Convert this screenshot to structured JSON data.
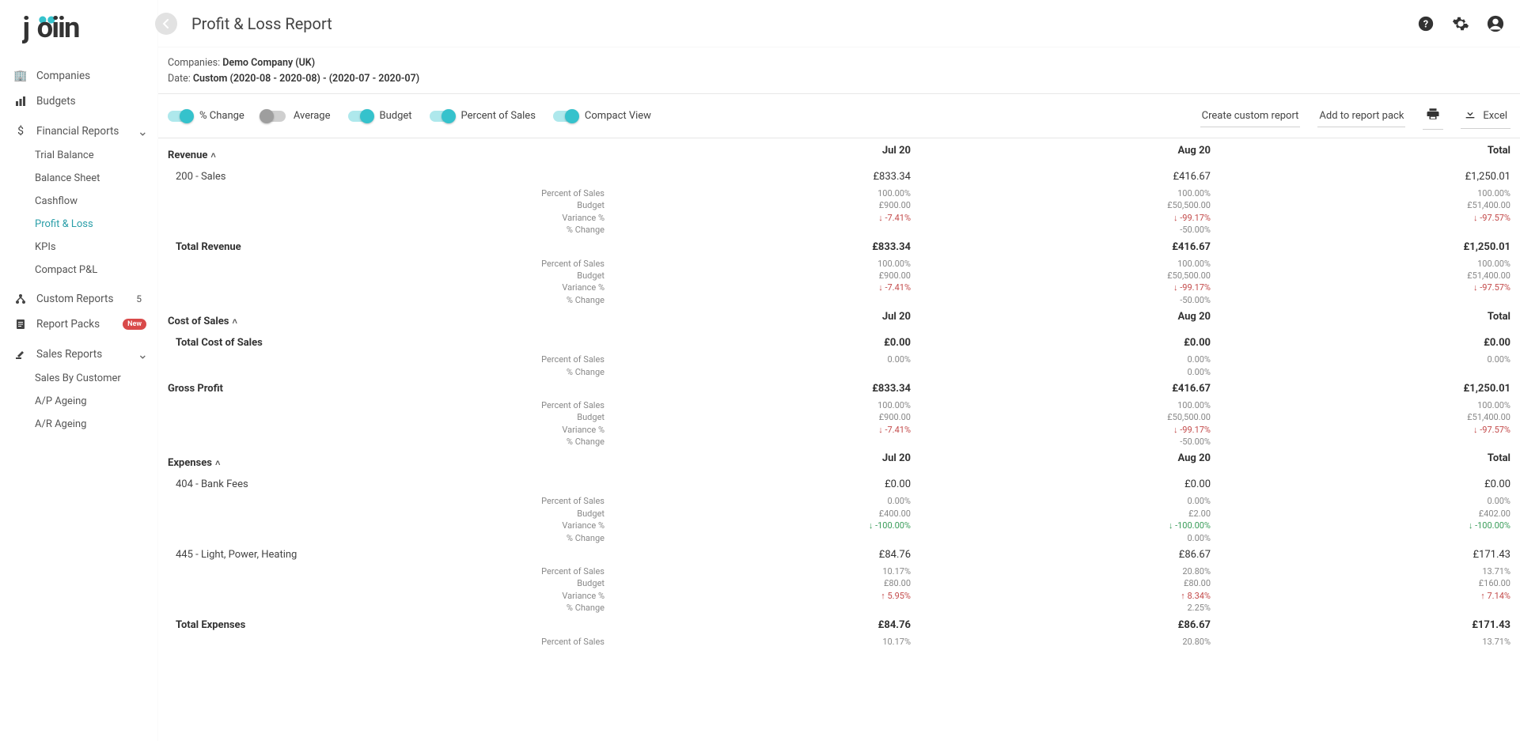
{
  "logo_text": "joiin",
  "page_title": "Profit & Loss Report",
  "nav": {
    "companies": "Companies",
    "budgets": "Budgets",
    "financial_reports": "Financial Reports",
    "trial_balance": "Trial Balance",
    "balance_sheet": "Balance Sheet",
    "cashflow": "Cashflow",
    "profit_loss": "Profit & Loss",
    "kpis": "KPIs",
    "compact_pl": "Compact P&L",
    "custom_reports": "Custom Reports",
    "custom_reports_count": "5",
    "report_packs": "Report Packs",
    "report_packs_badge": "New",
    "sales_reports": "Sales Reports",
    "sales_by_customer": "Sales By Customer",
    "ap_ageing": "A/P Ageing",
    "ar_ageing": "A/R Ageing"
  },
  "subheader": {
    "companies_label": "Companies: ",
    "companies_value": "Demo Company (UK)",
    "date_label": "Date: ",
    "date_value": "Custom (2020-08 - 2020-08) - (2020-07 - 2020-07)"
  },
  "toggles": {
    "pct_change": "% Change",
    "average": "Average",
    "budget": "Budget",
    "pct_sales": "Percent of Sales",
    "compact": "Compact View"
  },
  "actions": {
    "create_custom": "Create custom report",
    "add_pack": "Add to report pack",
    "excel": "Excel"
  },
  "columns": {
    "c1": "Jul 20",
    "c2": "Aug 20",
    "c3": "Total"
  },
  "sublabels": {
    "pct_sales": "Percent of Sales",
    "budget": "Budget",
    "variance": "Variance %",
    "pct_change": "% Change"
  },
  "report": {
    "revenue": {
      "title": "Revenue",
      "line_200": {
        "name": "200 - Sales",
        "v": [
          "£833.34",
          "£416.67",
          "£1,250.01"
        ],
        "pct_sales": [
          "100.00%",
          "100.00%",
          "100.00%"
        ],
        "budget": [
          "£900.00",
          "£50,500.00",
          "£51,400.00"
        ],
        "variance": [
          "-7.41%",
          "-99.17%",
          "-97.57%"
        ],
        "pct_change": [
          "",
          "-50.00%",
          ""
        ]
      },
      "total": {
        "name": "Total Revenue",
        "v": [
          "£833.34",
          "£416.67",
          "£1,250.01"
        ],
        "pct_sales": [
          "100.00%",
          "100.00%",
          "100.00%"
        ],
        "budget": [
          "£900.00",
          "£50,500.00",
          "£51,400.00"
        ],
        "variance": [
          "-7.41%",
          "-99.17%",
          "-97.57%"
        ],
        "pct_change": [
          "",
          "-50.00%",
          ""
        ]
      }
    },
    "cost_of_sales": {
      "title": "Cost of Sales",
      "total": {
        "name": "Total Cost of Sales",
        "v": [
          "£0.00",
          "£0.00",
          "£0.00"
        ],
        "pct_sales": [
          "0.00%",
          "0.00%",
          "0.00%"
        ],
        "pct_change": [
          "",
          "0.00%",
          ""
        ]
      }
    },
    "gross_profit": {
      "name": "Gross Profit",
      "v": [
        "£833.34",
        "£416.67",
        "£1,250.01"
      ],
      "pct_sales": [
        "100.00%",
        "100.00%",
        "100.00%"
      ],
      "budget": [
        "£900.00",
        "£50,500.00",
        "£51,400.00"
      ],
      "variance": [
        "-7.41%",
        "-99.17%",
        "-97.57%"
      ],
      "pct_change": [
        "",
        "-50.00%",
        ""
      ]
    },
    "expenses": {
      "title": "Expenses",
      "line_404": {
        "name": "404 - Bank Fees",
        "v": [
          "£0.00",
          "£0.00",
          "£0.00"
        ],
        "pct_sales": [
          "0.00%",
          "0.00%",
          "0.00%"
        ],
        "budget": [
          "£400.00",
          "£2.00",
          "£402.00"
        ],
        "variance": [
          "-100.00%",
          "-100.00%",
          "-100.00%"
        ],
        "pct_change": [
          "",
          "0.00%",
          ""
        ]
      },
      "line_445": {
        "name": "445 - Light, Power, Heating",
        "v": [
          "£84.76",
          "£86.67",
          "£171.43"
        ],
        "pct_sales": [
          "10.17%",
          "20.80%",
          "13.71%"
        ],
        "budget": [
          "£80.00",
          "£80.00",
          "£160.00"
        ],
        "variance": [
          "5.95%",
          "8.34%",
          "7.14%"
        ],
        "pct_change": [
          "",
          "2.25%",
          ""
        ]
      },
      "total": {
        "name": "Total Expenses",
        "v": [
          "£84.76",
          "£86.67",
          "£171.43"
        ],
        "pct_sales": [
          "10.17%",
          "20.80%",
          "13.71%"
        ]
      }
    }
  }
}
